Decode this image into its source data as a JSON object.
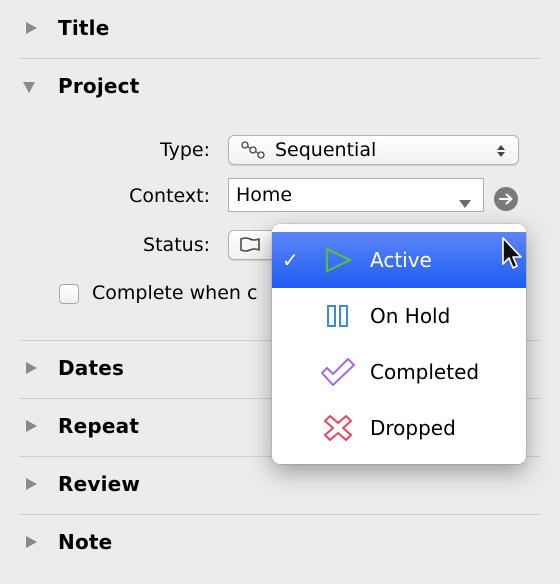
{
  "sections": {
    "title": {
      "label": "Title",
      "expanded": false
    },
    "project": {
      "label": "Project",
      "expanded": true
    },
    "dates": {
      "label": "Dates",
      "expanded": false
    },
    "repeat": {
      "label": "Repeat",
      "expanded": false
    },
    "review": {
      "label": "Review",
      "expanded": false
    },
    "note": {
      "label": "Note",
      "expanded": false
    }
  },
  "project": {
    "type_label": "Type:",
    "type_value": "Sequential",
    "type_icon": "sequential-icon",
    "context_label": "Context:",
    "context_value": "Home",
    "status_label": "Status:",
    "status_icon": "flag-icon",
    "complete_label": "Complete when c",
    "complete_checked": false
  },
  "status_menu": {
    "items": [
      {
        "label": "Active",
        "icon": "play-icon",
        "color": "#5db84a",
        "selected": true
      },
      {
        "label": "On Hold",
        "icon": "pause-icon",
        "color": "#3b8bdc",
        "selected": false
      },
      {
        "label": "Completed",
        "icon": "checkmark-icon",
        "color": "#a66ad8",
        "selected": false
      },
      {
        "label": "Dropped",
        "icon": "x-icon",
        "color": "#e8465e",
        "selected": false
      }
    ],
    "check_glyph": "✓"
  },
  "colors": {
    "accent": "#2a63f3",
    "background": "#ececec"
  }
}
